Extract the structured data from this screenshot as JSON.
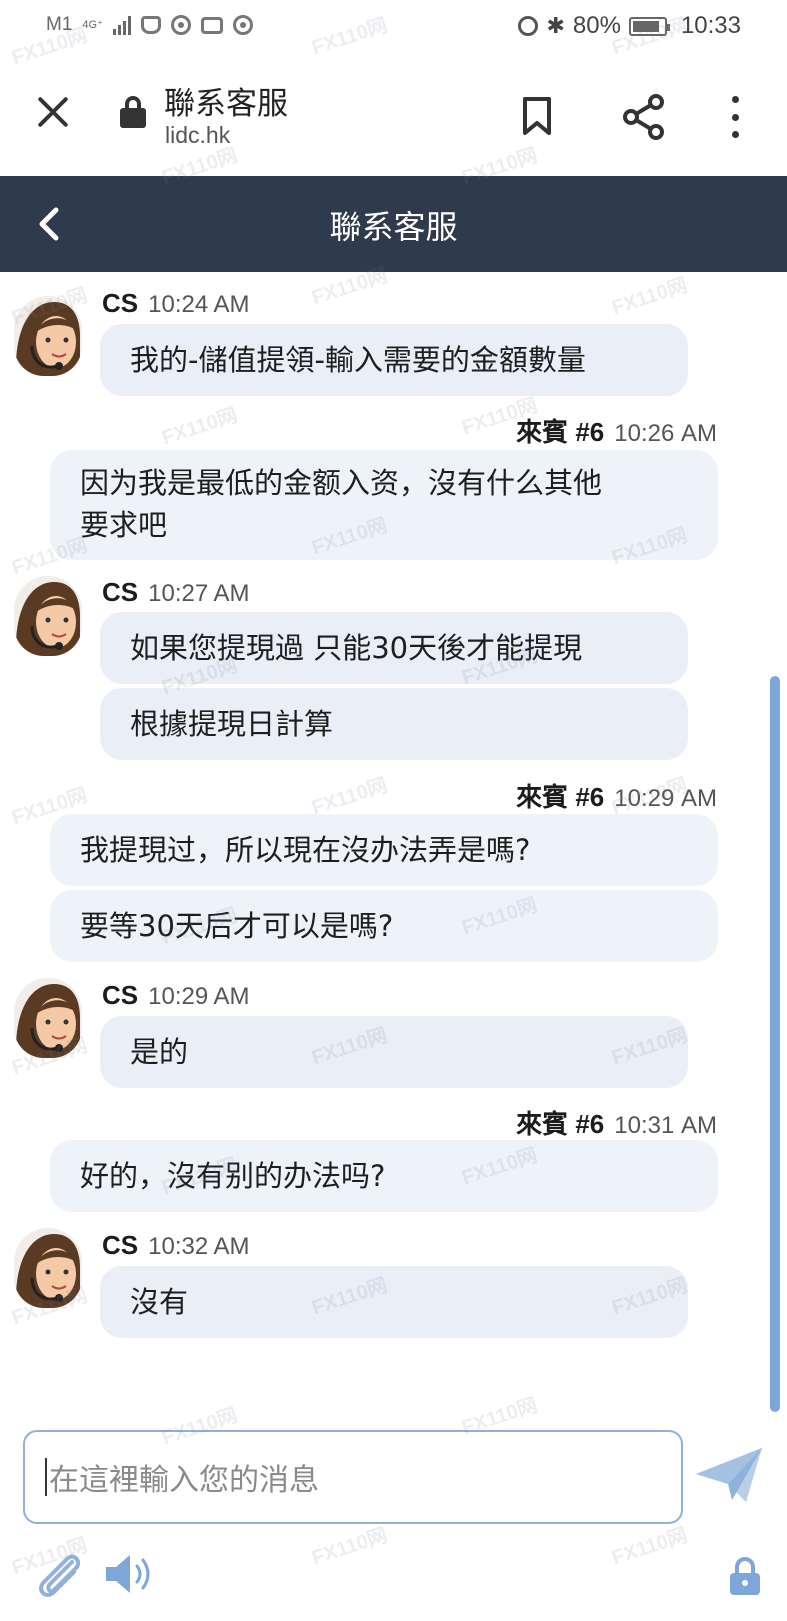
{
  "status_bar": {
    "carrier": "M1",
    "network": "4G⁺",
    "battery": "80%",
    "time": "10:33"
  },
  "browser": {
    "title": "聯系客服",
    "url": "lidc.hk",
    "icons": [
      "close-icon",
      "lock-icon",
      "bookmark-icon",
      "share-icon",
      "more-icon"
    ]
  },
  "header": {
    "title": "聯系客服"
  },
  "messages": [
    {
      "sender": "CS",
      "time": "10:24 AM",
      "lines": [
        "我的-儲值提領-輸入需要的金額數量"
      ]
    },
    {
      "sender": "來賓 #6",
      "time": "10:26 AM",
      "lines": [
        "因为我是最低的金额入资，沒有什么其他\n要求吧"
      ]
    },
    {
      "sender": "CS",
      "time": "10:27 AM",
      "lines": [
        "如果您提現過 只能30天後才能提現",
        "根據提現日計算"
      ]
    },
    {
      "sender": "來賓 #6",
      "time": "10:29 AM",
      "lines": [
        "我提現过，所以現在沒办法弄是嗎?",
        "要等30天后才可以是嗎?"
      ]
    },
    {
      "sender": "CS",
      "time": "10:29 AM",
      "lines": [
        "是的"
      ]
    },
    {
      "sender": "來賓 #6",
      "time": "10:31 AM",
      "lines": [
        "好的，沒有别的办法吗?"
      ]
    },
    {
      "sender": "CS",
      "time": "10:32 AM",
      "lines": [
        "沒有"
      ]
    }
  ],
  "composer": {
    "placeholder": "在這裡輸入您的消息"
  },
  "watermark": "FX110网",
  "colors": {
    "header_bg": "#2f3a4c",
    "cs_bubble": "#e9eef7",
    "guest_bubble": "#eef3fa",
    "accent": "#7ea6d8"
  }
}
